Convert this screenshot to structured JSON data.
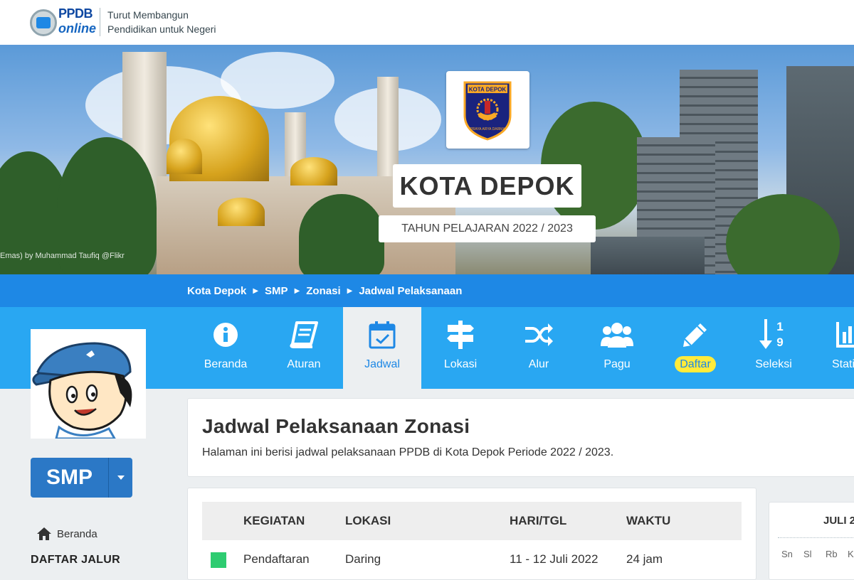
{
  "header": {
    "logo_line1": "PPDB",
    "logo_line2": "online",
    "tagline_line1": "Turut Membangun",
    "tagline_line2": "Pendidikan untuk Negeri"
  },
  "hero": {
    "emblem_text": "KOTA DEPOK",
    "emblem_motto": "PRAYA ARYA DARMA",
    "city": "KOTA DEPOK",
    "school_year": "TAHUN PELAJARAN 2022 / 2023",
    "photo_credit": "Emas) by Muhammad Taufiq @Flikr"
  },
  "breadcrumb": [
    "Kota Depok",
    "SMP",
    "Zonasi",
    "Jadwal Pelaksanaan"
  ],
  "nav": [
    {
      "label": "Beranda",
      "icon": "info-icon"
    },
    {
      "label": "Aturan",
      "icon": "book-icon"
    },
    {
      "label": "Jadwal",
      "icon": "calendar-check-icon",
      "active": true
    },
    {
      "label": "Lokasi",
      "icon": "signpost-icon"
    },
    {
      "label": "Alur",
      "icon": "random-arrows-icon"
    },
    {
      "label": "Pagu",
      "icon": "users-icon"
    },
    {
      "label": "Daftar",
      "icon": "pencil-icon",
      "highlight": "#ffeb3b"
    },
    {
      "label": "Seleksi",
      "icon": "sort-numeric-icon"
    },
    {
      "label": "Statistik",
      "icon": "bar-chart-icon"
    }
  ],
  "sidebar": {
    "level_button": "SMP",
    "home_link": "Beranda",
    "section_title": "DAFTAR JALUR"
  },
  "main": {
    "title": "Jadwal Pelaksanaan Zonasi",
    "description": "Halaman ini berisi jadwal pelaksanaan PPDB di Kota Depok Periode 2022 / 2023.",
    "table": {
      "headers": [
        "KEGIATAN",
        "LOKASI",
        "HARI/TGL",
        "WAKTU"
      ],
      "rows": [
        {
          "kegiatan": "Pendaftaran",
          "lokasi": "Daring",
          "tanggal": "11 - 12 Juli 2022",
          "waktu": "24 jam",
          "status_color": "#2ecc71"
        }
      ]
    }
  },
  "calendar": {
    "month_title": "JULI 2",
    "days": [
      "Sn",
      "Sl",
      "Rb",
      "Km"
    ]
  },
  "colors": {
    "primary": "#1e88e5",
    "nav_band": "#29a7f2",
    "smp_button": "#2b78c6",
    "status_green": "#2ecc71"
  }
}
